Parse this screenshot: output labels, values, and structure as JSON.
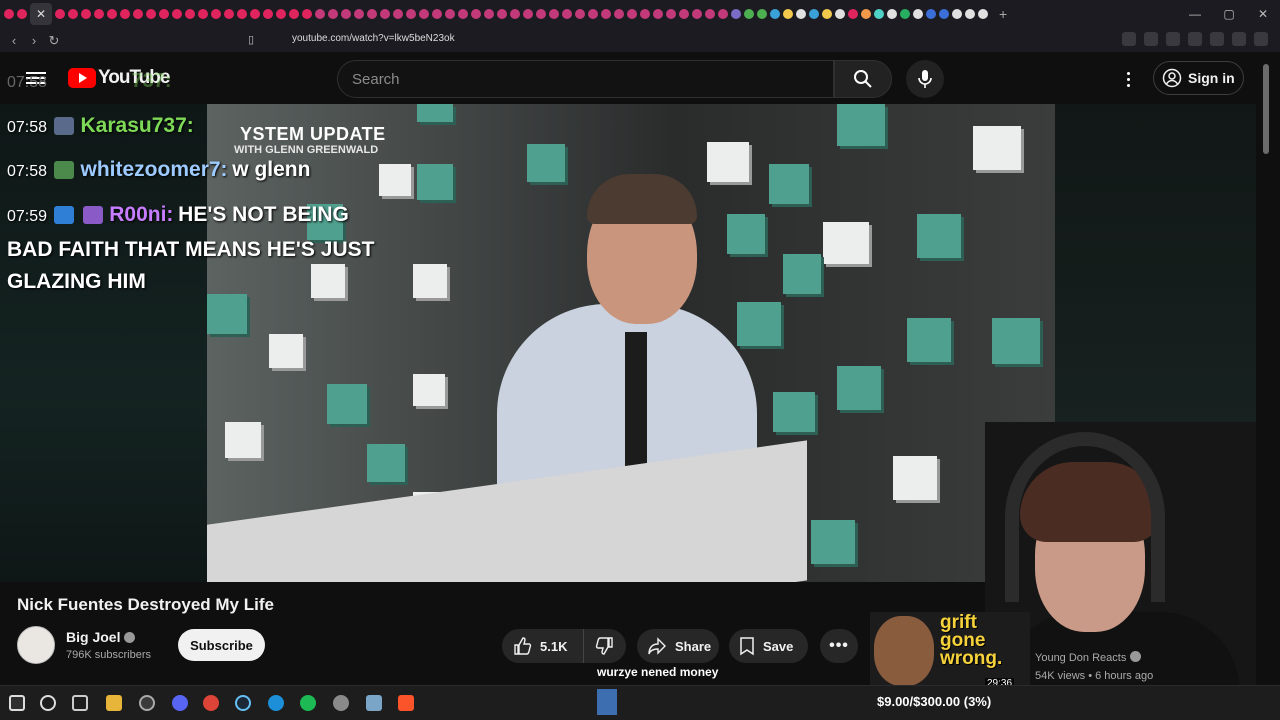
{
  "browser": {
    "url": "youtube.com/watch?v=lkw5beN23ok",
    "tab_close": "✕",
    "new_tab": "+",
    "win_min": "—",
    "win_max": "▢",
    "win_close": "✕"
  },
  "header": {
    "logo_text": "YouTube",
    "search_placeholder": "Search",
    "signin_label": "Sign in"
  },
  "chat": {
    "ghost_time": "07:58",
    "ghost_name": "737:",
    "lines": [
      {
        "time": "07:58",
        "name": "Karasu737:",
        "name_color": "#7ed957",
        "message": ""
      },
      {
        "time": "07:58",
        "name": "whitezoomer7:",
        "name_color": "#9ecbff",
        "message": "w glenn"
      },
      {
        "time": "07:59",
        "name": "R00ni:",
        "name_color": "#c77dff",
        "message": "HE'S NOT BEING"
      }
    ],
    "wrap_1": "BAD FAITH THAT MEANS HE'S JUST",
    "wrap_2": "GLAZING HIM"
  },
  "video_overlay": {
    "show_title": "YSTEM UPDATE",
    "show_subtitle": "WITH GLENN GREENWALD"
  },
  "video": {
    "title": "Nick Fuentes Destroyed My Life",
    "channel": "Big Joel",
    "subscribers": "796K subscribers",
    "subscribe_label": "Subscribe",
    "like_count": "5.1K",
    "share_label": "Share",
    "save_label": "Save",
    "caption": "wurzye nened money"
  },
  "recommended": {
    "thumb_text_1": "grift",
    "thumb_text_2": "gone",
    "thumb_text_3": "wrong.",
    "duration": "29:36",
    "channel": "Young Don Reacts",
    "meta": "54K views • 6 hours ago"
  },
  "stream_goal": {
    "label": "$9.00/$300.00 (3%)",
    "progress": 0.03
  },
  "colors": {
    "accent_red": "#ff0000",
    "goal_fill": "#3d6fb0"
  }
}
